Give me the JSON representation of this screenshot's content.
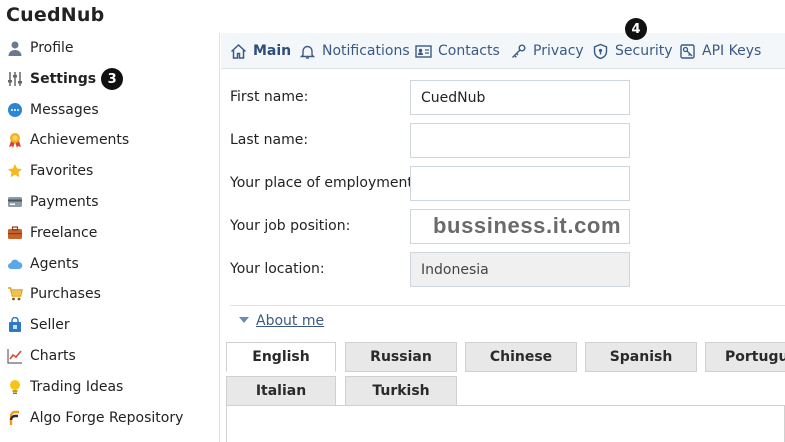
{
  "app": {
    "title": "CuedNub"
  },
  "sidebar": {
    "items": [
      {
        "label": "Profile",
        "icon": "user-icon"
      },
      {
        "label": "Settings",
        "icon": "sliders-icon",
        "active": true,
        "badge": "3"
      },
      {
        "label": "Messages",
        "icon": "chat-icon"
      },
      {
        "label": "Achievements",
        "icon": "medal-icon"
      },
      {
        "label": "Favorites",
        "icon": "star-icon"
      },
      {
        "label": "Payments",
        "icon": "card-icon"
      },
      {
        "label": "Freelance",
        "icon": "briefcase-icon"
      },
      {
        "label": "Agents",
        "icon": "cloud-icon"
      },
      {
        "label": "Purchases",
        "icon": "cart-icon"
      },
      {
        "label": "Seller",
        "icon": "shop-icon"
      },
      {
        "label": "Charts",
        "icon": "chart-icon"
      },
      {
        "label": "Trading Ideas",
        "icon": "lightbulb-icon"
      },
      {
        "label": "Algo Forge Repository",
        "icon": "fork-icon"
      }
    ]
  },
  "topnav": {
    "tabs": [
      {
        "label": "Main",
        "icon": "home-icon",
        "active": true
      },
      {
        "label": "Notifications",
        "icon": "bell-icon"
      },
      {
        "label": "Contacts",
        "icon": "contact-card-icon"
      },
      {
        "label": "Privacy",
        "icon": "key-icon"
      },
      {
        "label": "Security",
        "icon": "shield-icon",
        "badge": "4"
      },
      {
        "label": "API Keys",
        "icon": "api-key-icon"
      }
    ]
  },
  "form": {
    "first_name": {
      "label": "First name:",
      "value": "CuedNub"
    },
    "last_name": {
      "label": "Last name:",
      "value": ""
    },
    "employment": {
      "label": "Your place of employment:",
      "value": ""
    },
    "job_position": {
      "label": "Your job position:",
      "value": "",
      "watermark": "bussiness.it.com"
    },
    "location": {
      "label": "Your location:",
      "value": "Indonesia"
    }
  },
  "about": {
    "label": "About me"
  },
  "languages": [
    "English",
    "Russian",
    "Chinese",
    "Spanish",
    "Portugues",
    "Italian",
    "Turkish"
  ],
  "colors": {
    "link": "#3a5a84",
    "nav_bg": "#f4f7fa",
    "badge": "#111111"
  }
}
